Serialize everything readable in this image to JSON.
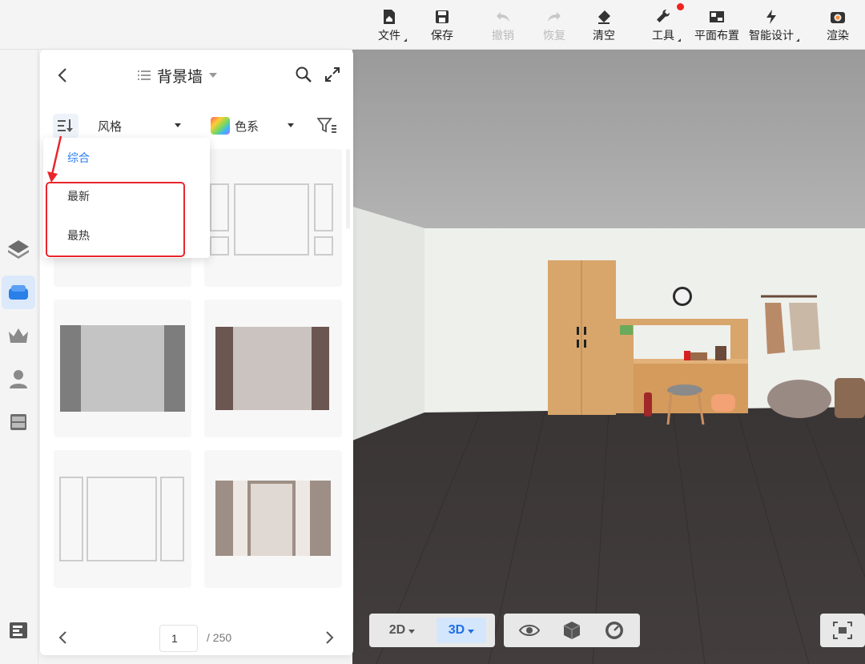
{
  "toolbar": {
    "items": [
      {
        "label": "文件",
        "icon": "file-home-icon",
        "disabled": false
      },
      {
        "label": "保存",
        "icon": "save-icon",
        "disabled": false
      },
      {
        "label": "撤销",
        "icon": "undo-icon",
        "disabled": true
      },
      {
        "label": "恢复",
        "icon": "redo-icon",
        "disabled": true
      },
      {
        "label": "清空",
        "icon": "eraser-icon",
        "disabled": false
      },
      {
        "label": "工具",
        "icon": "wrench-icon",
        "disabled": false,
        "notification": true
      },
      {
        "label": "平面布置",
        "icon": "floor-plan-icon",
        "disabled": false
      },
      {
        "label": "智能设计",
        "icon": "lightning-icon",
        "disabled": false
      },
      {
        "label": "渲染",
        "icon": "camera-icon",
        "disabled": false
      }
    ]
  },
  "rail": {
    "items": [
      {
        "icon": "layers-icon",
        "active": false
      },
      {
        "icon": "sofa-icon",
        "active": true
      },
      {
        "icon": "crown-icon",
        "active": false
      },
      {
        "icon": "user-icon",
        "active": false
      },
      {
        "icon": "cabinet-icon",
        "active": false
      },
      {
        "icon": "layout-icon",
        "active": false
      }
    ]
  },
  "panel": {
    "title": "背景墙",
    "filters": {
      "style_label": "风格",
      "color_label": "色系"
    },
    "sort_menu": {
      "options": [
        "综合",
        "最新",
        "最热"
      ],
      "selected": "综合"
    },
    "pagination": {
      "current": "1",
      "total": "/ 250"
    }
  },
  "view_toolbar": {
    "mode_2d": "2D",
    "mode_3d": "3D",
    "active_mode": "3D"
  },
  "colors": {
    "accent": "#2d7ff2",
    "highlight": "#e8262b",
    "floor": "#3d3838",
    "ceiling": "#a6a6a6"
  }
}
